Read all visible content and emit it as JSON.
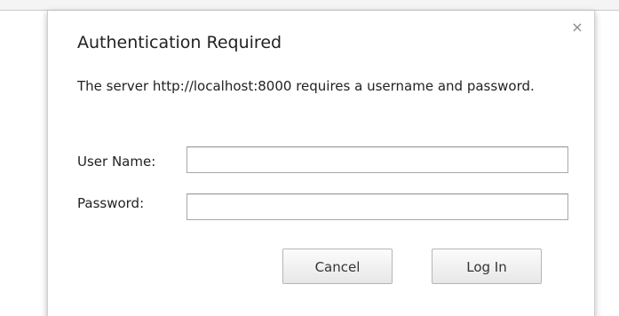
{
  "dialog": {
    "title": "Authentication Required",
    "message": "The server http://localhost:8000 requires a username and password.",
    "close_glyph": "×",
    "close_icon": "close-icon",
    "fields": {
      "username": {
        "label": "User Name:",
        "value": "",
        "placeholder": ""
      },
      "password": {
        "label": "Password:",
        "value": "",
        "placeholder": ""
      }
    },
    "buttons": {
      "cancel": "Cancel",
      "login": "Log In"
    }
  }
}
